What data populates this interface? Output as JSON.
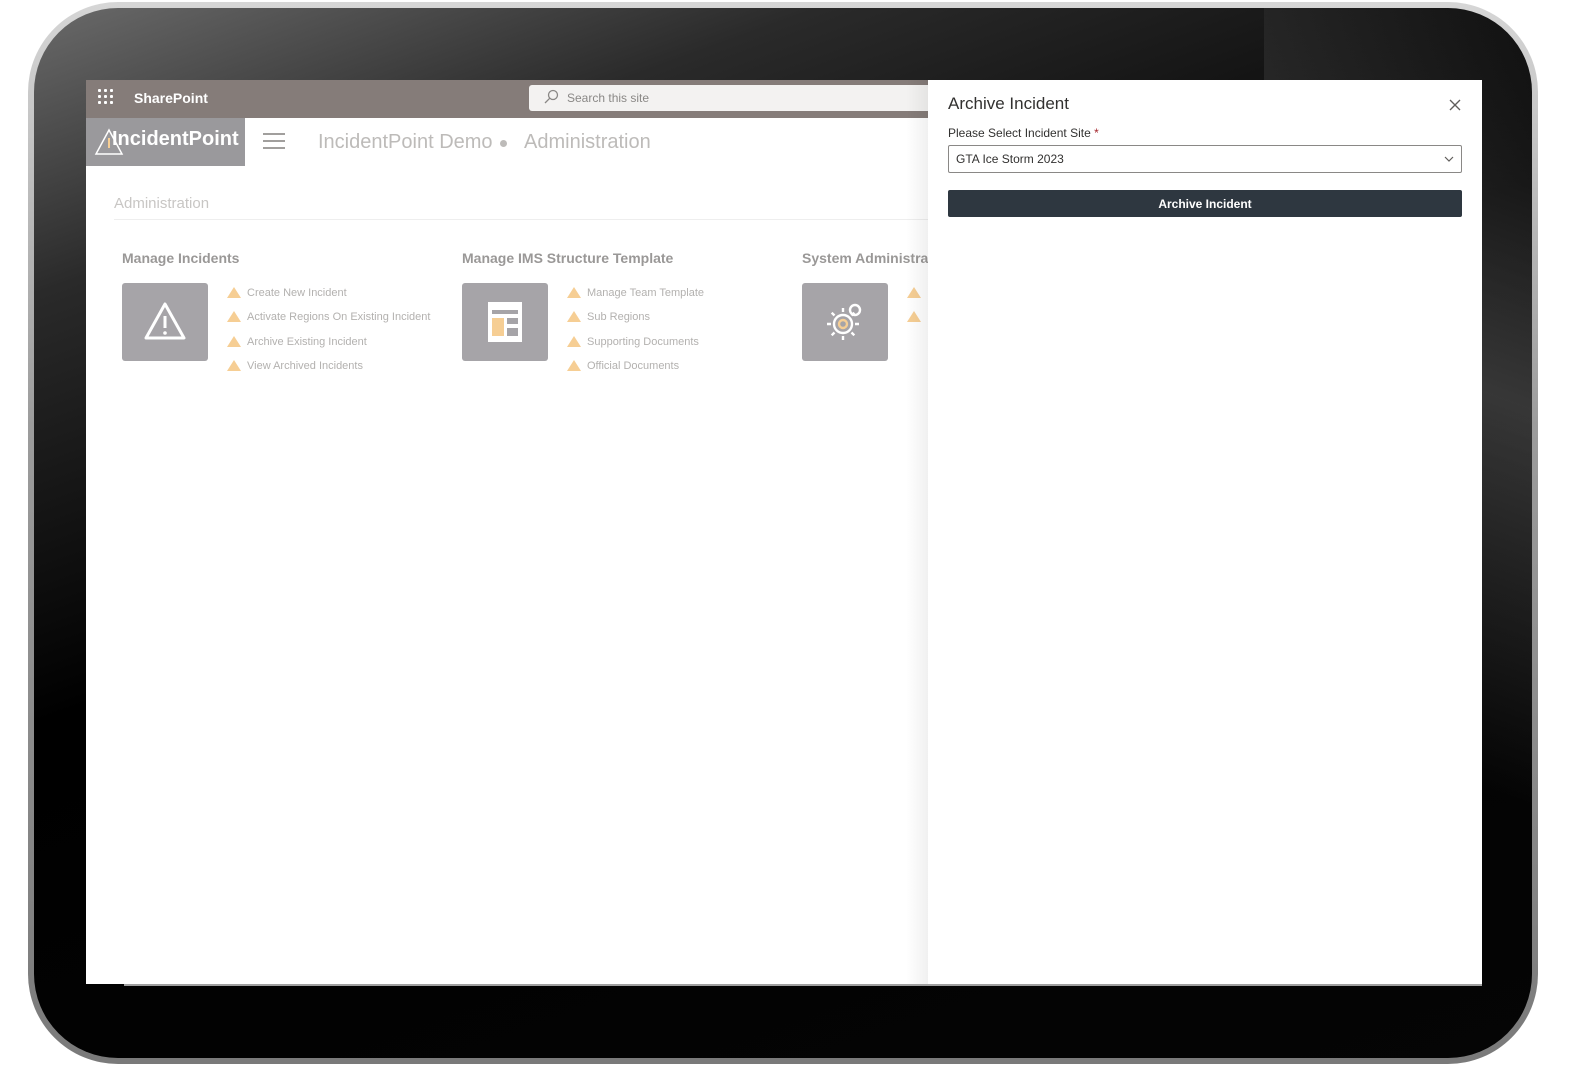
{
  "suitebar": {
    "app_name": "SharePoint",
    "search_placeholder": "Search this site"
  },
  "site_header": {
    "logo_text": "IncidentPoint",
    "site_name": "IncidentPoint Demo",
    "current_page": "Administration"
  },
  "page": {
    "heading": "Administration",
    "sections": [
      {
        "title": "Manage Incidents",
        "icon": "warning-icon",
        "links": [
          "Create New Incident",
          "Activate Regions On Existing Incident",
          "Archive Existing Incident",
          "View Archived Incidents"
        ]
      },
      {
        "title": "Manage IMS Structure Template",
        "icon": "template-icon",
        "links": [
          "Manage Team Template",
          "Sub Regions",
          "Supporting Documents",
          "Official Documents"
        ]
      },
      {
        "title": "System Administra",
        "icon": "gear-icon",
        "links": [
          "",
          ""
        ]
      }
    ]
  },
  "panel": {
    "title": "Archive Incident",
    "field_label": "Please Select Incident Site",
    "required_marker": "*",
    "selected_site": "GTA Ice Storm 2023",
    "submit_label": "Archive Incident"
  },
  "colors": {
    "suitebar": "#857c79",
    "logo_block": "#9a999c",
    "tile": "#a6a4a8",
    "bullet": "#f6ce94",
    "primary_button": "#2e3740"
  }
}
